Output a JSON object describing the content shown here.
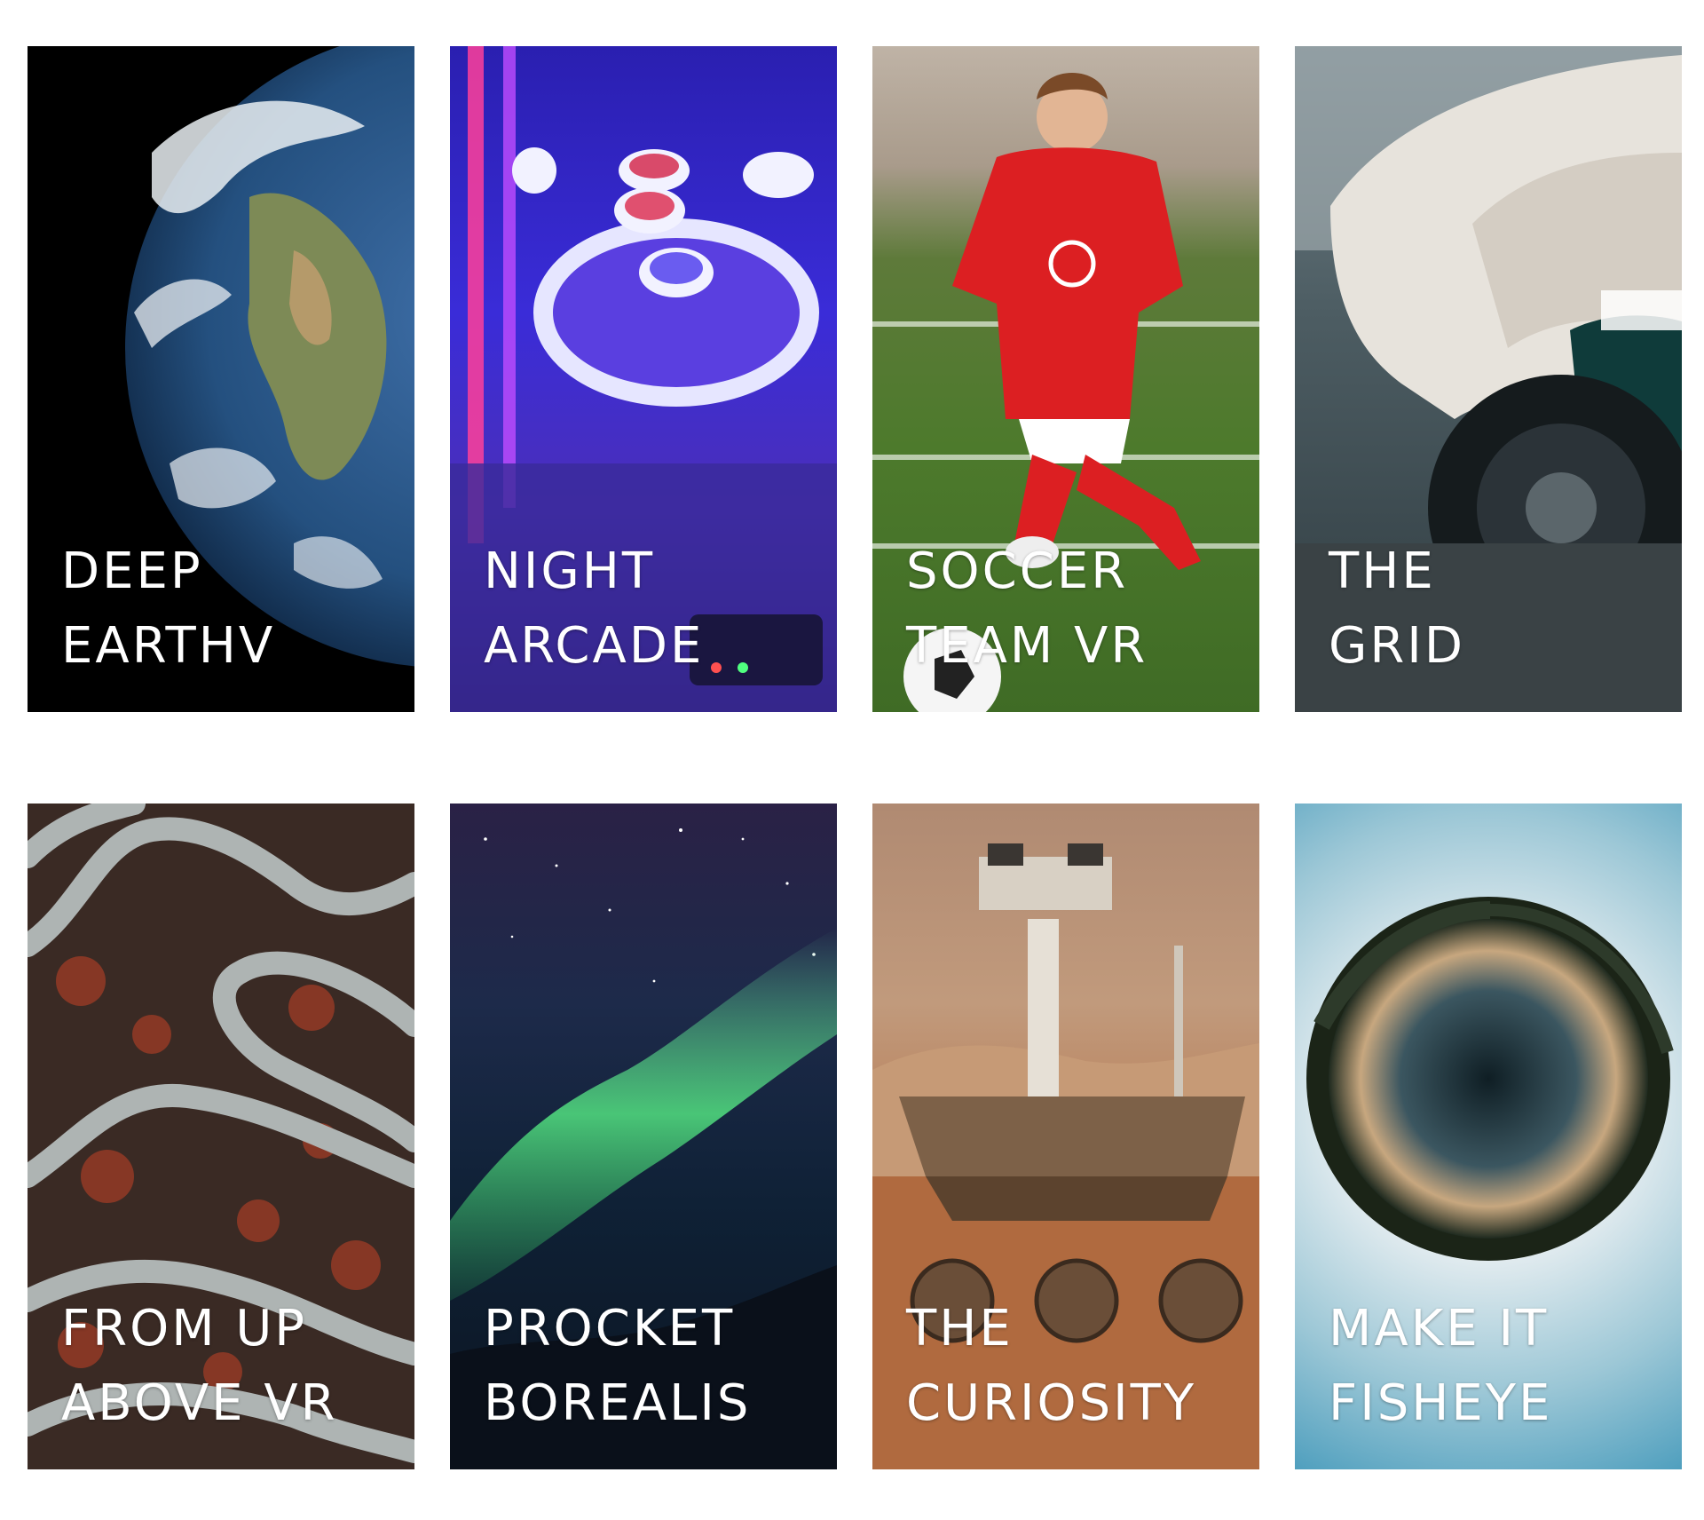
{
  "cards": [
    {
      "line1": "DEEP",
      "line2": "EARTHV",
      "image": "earth-from-space"
    },
    {
      "line1": "NIGHT",
      "line2": "ARCADE",
      "image": "skee-ball-arcade"
    },
    {
      "line1": "SOCCER",
      "line2": "TEAM VR",
      "image": "soccer-player"
    },
    {
      "line1": "THE",
      "line2": "GRID",
      "image": "race-car"
    },
    {
      "line1": "FROM UP",
      "line2": "ABOVE VR",
      "image": "aerial-winding-road"
    },
    {
      "line1": "PROCKET",
      "line2": "BOREALIS",
      "image": "aurora-borealis"
    },
    {
      "line1": "THE",
      "line2": "CURIOSITY",
      "image": "mars-rover"
    },
    {
      "line1": "MAKE IT",
      "line2": "FISHEYE",
      "image": "fisheye-planet"
    }
  ]
}
